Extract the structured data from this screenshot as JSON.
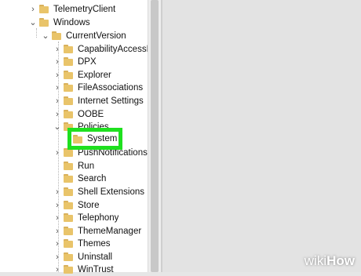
{
  "tree": {
    "items": [
      {
        "label": "TelemetryClient",
        "arrow": "›"
      },
      {
        "label": "Windows",
        "arrow": "⌄"
      },
      {
        "label": "CurrentVersion",
        "arrow": "⌄"
      },
      {
        "label": "CapabilityAccessM",
        "arrow": "›"
      },
      {
        "label": "DPX",
        "arrow": "›"
      },
      {
        "label": "Explorer",
        "arrow": "›"
      },
      {
        "label": "FileAssociations",
        "arrow": "›"
      },
      {
        "label": "Internet Settings",
        "arrow": "›"
      },
      {
        "label": "OOBE",
        "arrow": "›"
      },
      {
        "label": "Policies",
        "arrow": "⌄"
      },
      {
        "label": "PushNotifications",
        "arrow": "›"
      },
      {
        "label": "Run",
        "arrow": ""
      },
      {
        "label": "Search",
        "arrow": ""
      },
      {
        "label": "Shell Extensions",
        "arrow": "›"
      },
      {
        "label": "Store",
        "arrow": "›"
      },
      {
        "label": "Telephony",
        "arrow": "›"
      },
      {
        "label": "ThemeManager",
        "arrow": "›"
      },
      {
        "label": "Themes",
        "arrow": "›"
      },
      {
        "label": "Uninstall",
        "arrow": "›"
      },
      {
        "label": "WinTrust",
        "arrow": "›"
      }
    ],
    "selected": {
      "label": "System"
    }
  },
  "watermark": {
    "part1": "wiki",
    "part2": "How"
  },
  "colors": {
    "highlight": "#1fe01f",
    "folder": "#e9c46a"
  }
}
